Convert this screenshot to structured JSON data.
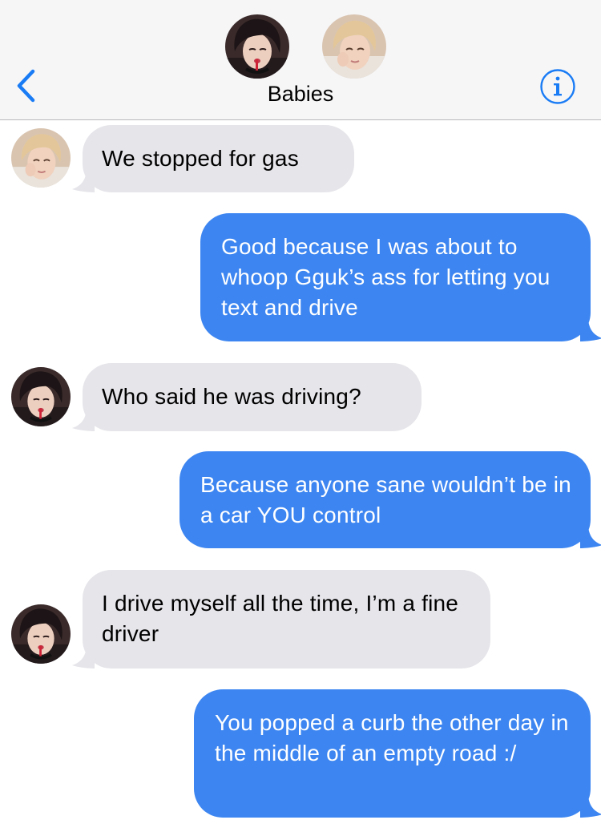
{
  "header": {
    "group_name": "Babies",
    "back_icon": "chevron-left-icon",
    "info_icon": "info-icon",
    "accent_color": "#1a7cf5"
  },
  "colors": {
    "incoming_bubble": "#e5e5ea",
    "outgoing_bubble": "#3d86f1",
    "header_bg": "#f6f6f7"
  },
  "messages": [
    {
      "direction": "incoming",
      "sender_avatar": "avatar-blond",
      "text": "We stopped for gas"
    },
    {
      "direction": "outgoing",
      "text": "Good because I was about to whoop Gguk’s ass for letting you text and drive"
    },
    {
      "direction": "incoming",
      "sender_avatar": "avatar-dark-hair",
      "text": "Who said he was driving?"
    },
    {
      "direction": "outgoing",
      "text": "Because anyone sane wouldn’t be in a car YOU control"
    },
    {
      "direction": "incoming",
      "sender_avatar": "avatar-dark-hair",
      "text": "I drive myself all the time, I’m a fine driver"
    },
    {
      "direction": "outgoing",
      "text": "You popped a curb the other day in the middle of an empty road :/"
    }
  ]
}
